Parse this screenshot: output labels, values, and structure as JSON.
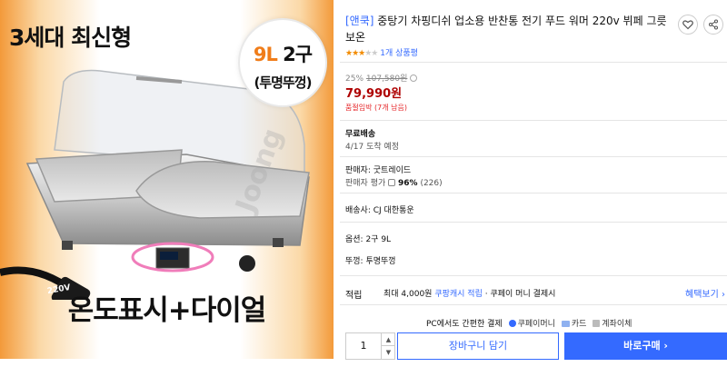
{
  "image": {
    "headline": "3세대 최신형",
    "badge_highlight": "9L",
    "badge_rest": " 2구",
    "badge_sub": "(투명뚜껑)",
    "footer": "온도표시+다이얼",
    "plug_label": "220V",
    "watermark": "Joong"
  },
  "product": {
    "brand": "[앤쿡]",
    "title": " 중탕기 차핑디쉬 업소용 반찬통 전기 푸드 워머 220v 뷔페 그릇 보온",
    "rating_stars": 3,
    "rating_max": 5,
    "reviews": "1개 상품평"
  },
  "price": {
    "discount_rate": "25%",
    "original": "107,580원",
    "sale": "79,990원",
    "soldout": "품절임박 (7개 남음)"
  },
  "delivery": {
    "type": "무료배송",
    "arrival": "4/17 도착 예정"
  },
  "seller": {
    "label": "판매자: 굿트레이드",
    "rating_label": "판매자 평가",
    "rating_value": "96%",
    "rating_count": "(226)"
  },
  "shipping": {
    "carrier": "배송사: CJ 대한통운"
  },
  "options": {
    "option": "옵션: 2구 9L",
    "lid": "뚜껑: 투명뚜껑"
  },
  "reward": {
    "label": "적립",
    "prefix": "최대 4,000원 ",
    "cash": "쿠팡캐시 적립",
    "suffix": " · 쿠페이 머니 결제시",
    "benefits_link": "혜택보기 ›"
  },
  "payment": {
    "lead": "PC에서도 간편한 결제",
    "coupay": "쿠페이머니",
    "card": "카드",
    "account": "계좌이체"
  },
  "actions": {
    "quantity": "1",
    "up": "▲",
    "down": "▼",
    "cart": "장바구니 담기",
    "buy": "바로구매 ›"
  },
  "colors": {
    "accent": "#346aff",
    "price": "#ae0000",
    "soldout": "#e52528",
    "image_bg": "#f39a3a"
  }
}
